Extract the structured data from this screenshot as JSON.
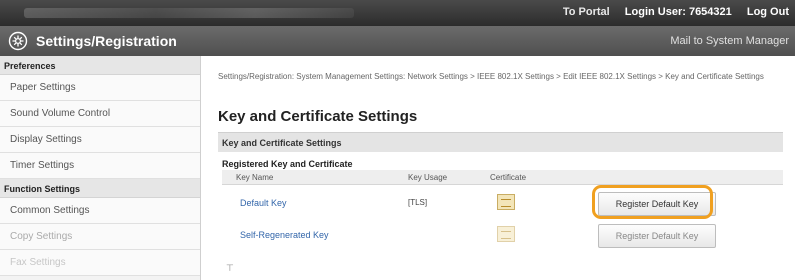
{
  "topbar": {
    "portal": "To Portal",
    "login_user": "Login User: 7654321",
    "logout": "Log Out"
  },
  "header": {
    "title": "Settings/Registration",
    "mail_link": "Mail to System Manager",
    "icon": "gear-icon"
  },
  "sidebar": {
    "sections": [
      {
        "title": "Preferences",
        "items": [
          "Paper Settings",
          "Sound Volume Control",
          "Display Settings",
          "Timer Settings"
        ]
      },
      {
        "title": "Function Settings",
        "items": [
          "Common Settings",
          "Copy Settings",
          "Fax Settings"
        ]
      }
    ]
  },
  "main": {
    "breadcrumb": "Settings/Registration: System Management Settings: Network Settings > IEEE 802.1X Settings > Edit IEEE 802.1X Settings > Key and Certificate Settings",
    "page_title": "Key and Certificate Settings",
    "section_title": "Key and Certificate Settings",
    "sub_title": "Registered Key and Certificate",
    "table": {
      "headers": {
        "key_name": "Key Name",
        "key_usage": "Key Usage",
        "certificate": "Certificate"
      },
      "rows": [
        {
          "key_name": "Default Key",
          "key_usage": "[TLS]",
          "button": "Register Default Key"
        },
        {
          "key_name": "Self-Regenerated Key",
          "key_usage": "",
          "button": "Register Default Key"
        }
      ]
    }
  },
  "colors": {
    "highlight": "#f0a020",
    "link": "#3366aa",
    "header_bg": "#4f4f4f"
  }
}
